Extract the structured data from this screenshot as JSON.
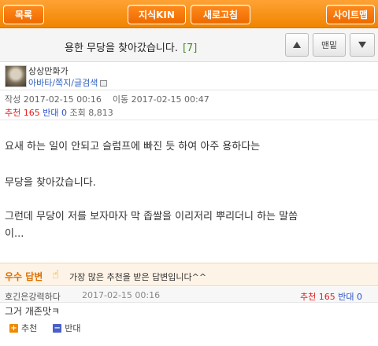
{
  "topbar": {
    "list_label": "목록",
    "kin_label": "지식KIN",
    "refresh_label": "새로고침",
    "sitemap_label": "사이트맵"
  },
  "title": {
    "text": "용한 무당을 찾아갔습니다.",
    "count": "[7]"
  },
  "nav": {
    "bottom_label": "맨밑"
  },
  "author": {
    "nickname": "상상만화가",
    "links": "아바타/쪽지/글검색"
  },
  "meta": {
    "written_label": "작성",
    "written": "2017-02-15 00:16",
    "moved_label": "이동",
    "moved": "2017-02-15 00:47",
    "recommend_label": "추천",
    "recommend": "165",
    "oppose_label": "반대",
    "oppose": "0",
    "views_label": "조회",
    "views": "8,813"
  },
  "body": {
    "p1": "요새 하는 일이 안되고 슬럼프에 빠진 듯 하여 아주 용하다는",
    "p2": "무당을 찾아갔습니다.",
    "p3a": "그런데 무당이 저를 보자마자 막 좁쌀을 이리저리 뿌리더니 하는 말씀",
    "p3b": "이..."
  },
  "best": {
    "badge": "우수 답변",
    "desc": "가장 많은 추천을 받은 답변입니다^^"
  },
  "reply": {
    "name": "호긴은강력하다",
    "date": "2017-02-15 00:16",
    "recommend": "추천 165",
    "oppose": "반대 0",
    "text": "그거 개존맛ㅋ",
    "recommend_btn": "추천",
    "oppose_btn": "반대"
  }
}
